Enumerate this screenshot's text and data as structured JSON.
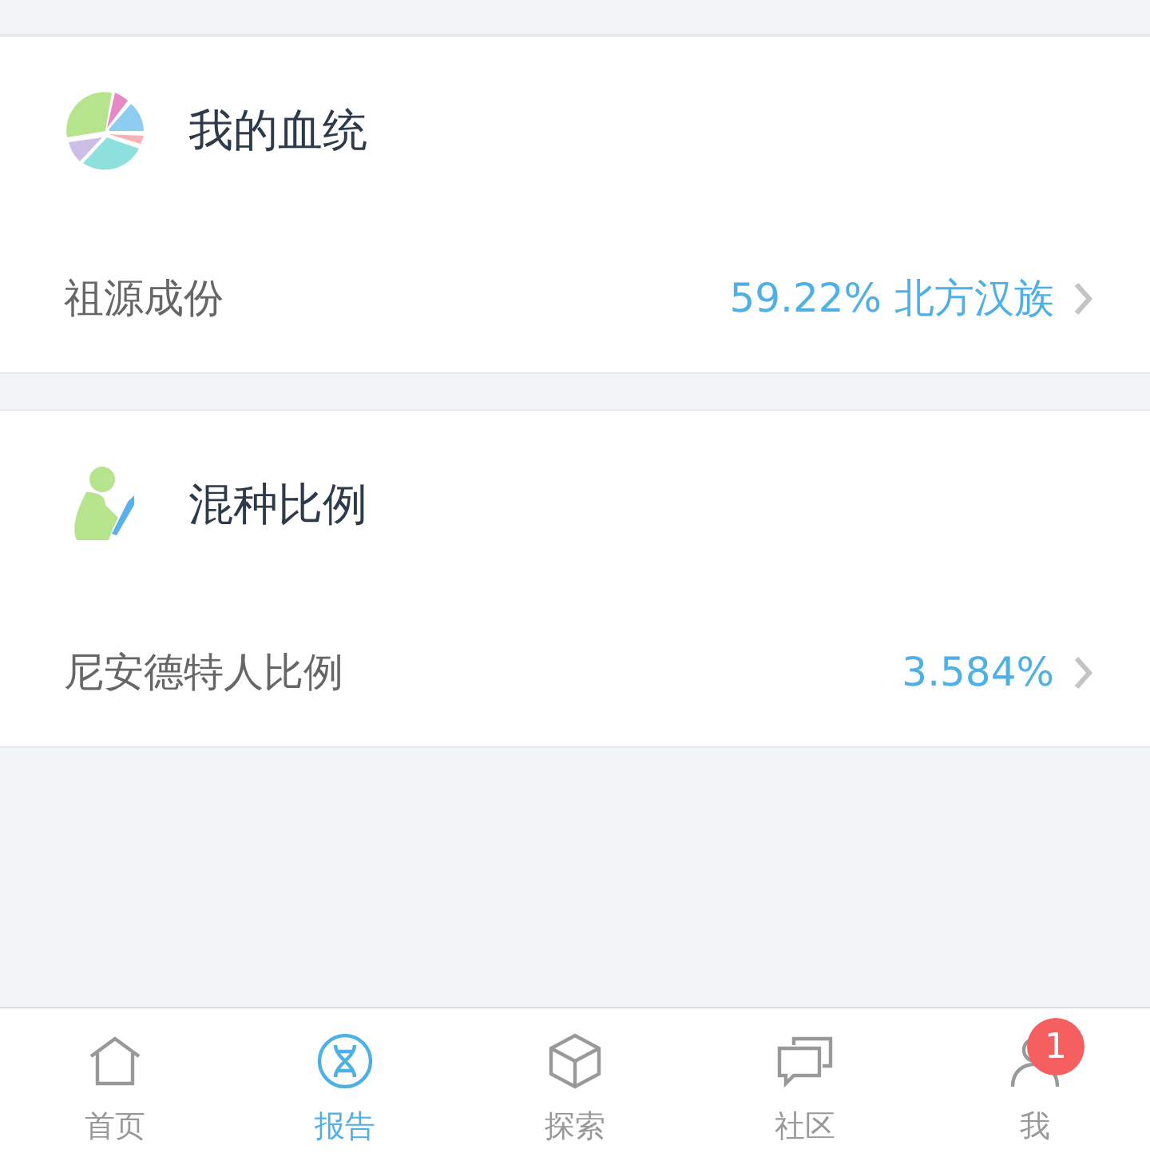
{
  "cards": [
    {
      "kind": "pie",
      "title": "我的血统",
      "row": {
        "label": "祖源成份",
        "value": "59.22% 北方汉族"
      }
    },
    {
      "kind": "figure",
      "title": "混种比例",
      "row": {
        "label": "尼安德特人比例",
        "value": "3.584%"
      }
    }
  ],
  "tabs": [
    {
      "kind": "home",
      "label": "首页",
      "selected": false
    },
    {
      "kind": "dna",
      "label": "报告",
      "selected": true
    },
    {
      "kind": "cube",
      "label": "探索",
      "selected": false
    },
    {
      "kind": "chat",
      "label": "社区",
      "selected": false
    },
    {
      "kind": "person",
      "label": "我",
      "selected": false,
      "badge": "1"
    }
  ]
}
